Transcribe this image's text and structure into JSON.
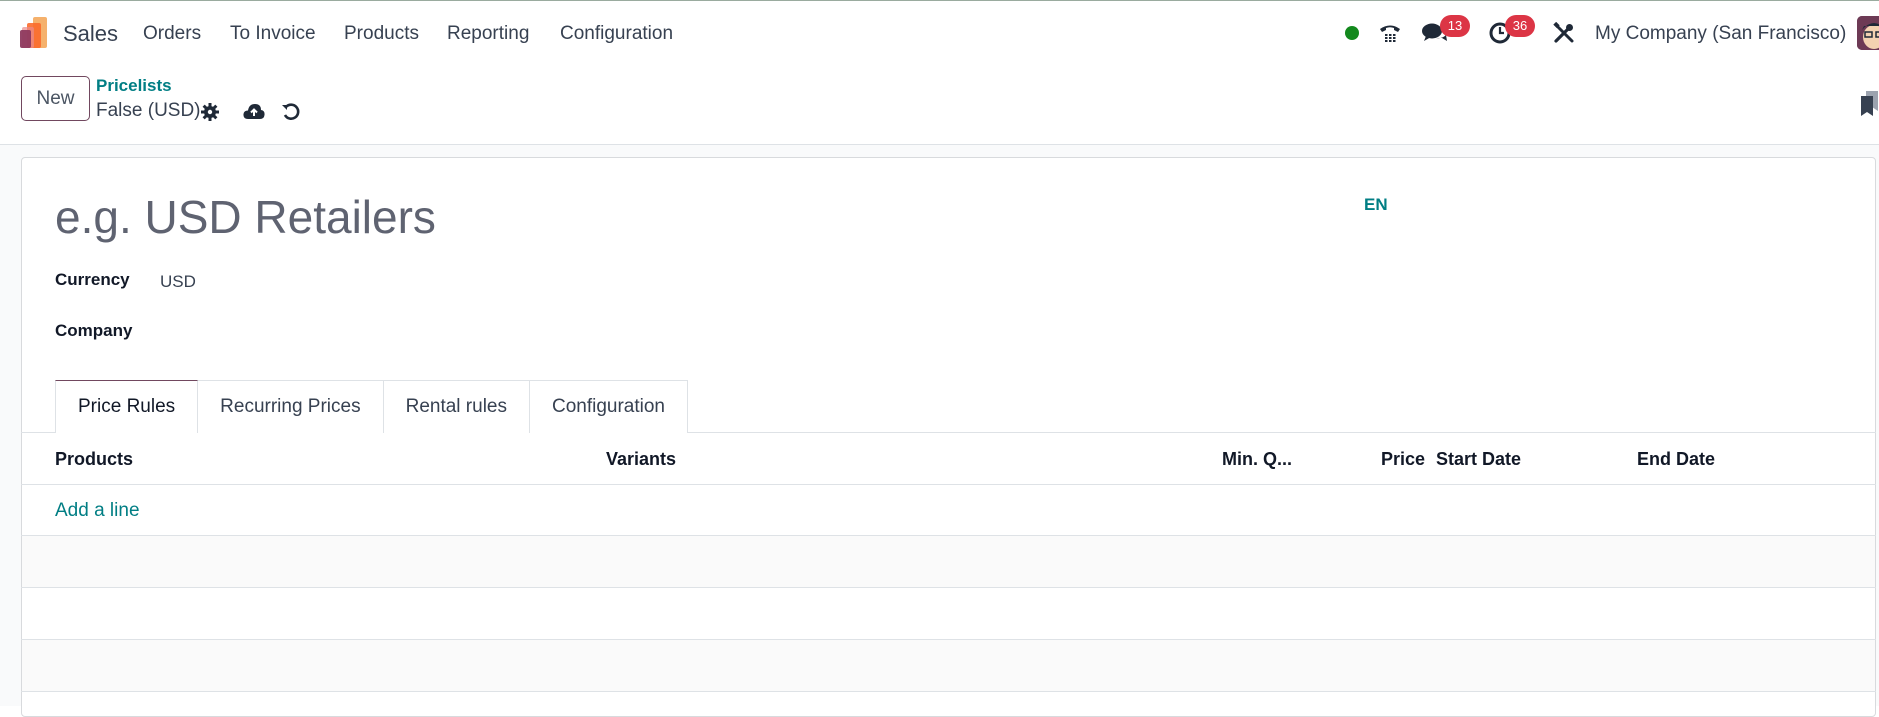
{
  "navbar": {
    "app_name": "Sales",
    "menu": [
      {
        "label": "Orders"
      },
      {
        "label": "To Invoice"
      },
      {
        "label": "Products"
      },
      {
        "label": "Reporting"
      },
      {
        "label": "Configuration"
      }
    ],
    "systray": {
      "status_color": "#13891d",
      "messages_count": "13",
      "activities_count": "36",
      "company": "My Company (San Francisco)"
    }
  },
  "control_panel": {
    "new_label": "New",
    "breadcrumb": "Pricelists",
    "record_name": "False (USD)",
    "icons": [
      "gear-icon",
      "cloud-upload-icon",
      "undo-icon"
    ]
  },
  "form": {
    "title_placeholder": "e.g. USD Retailers",
    "language": "EN",
    "fields": [
      {
        "label": "Currency",
        "value": "USD"
      },
      {
        "label": "Company",
        "value": ""
      }
    ],
    "tabs": [
      {
        "label": "Price Rules",
        "active": true
      },
      {
        "label": "Recurring Prices",
        "active": false
      },
      {
        "label": "Rental rules",
        "active": false
      },
      {
        "label": "Configuration",
        "active": false
      }
    ],
    "table": {
      "columns": [
        "Products",
        "Variants",
        "Min. Q...",
        "Price",
        "Start Date",
        "End Date"
      ],
      "add_line_label": "Add a line",
      "rows": []
    }
  },
  "colors": {
    "primary": "#71485f",
    "link": "#017e84",
    "badge": "#dc3545"
  }
}
